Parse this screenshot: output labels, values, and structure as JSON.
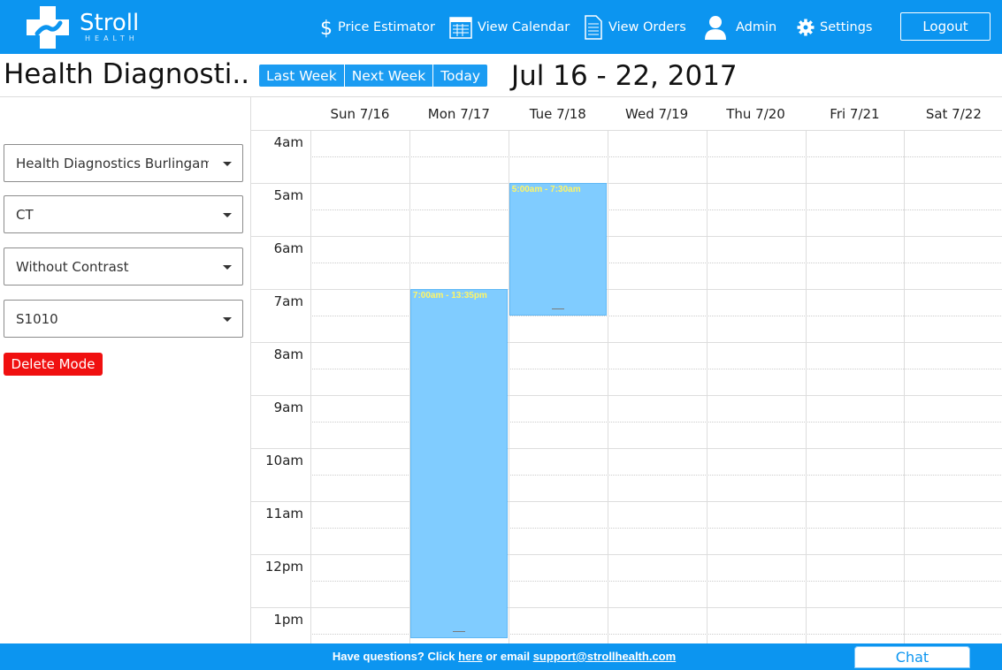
{
  "brand": {
    "name": "Stroll",
    "tagline": "HEALTH",
    "color": "#0c95f0"
  },
  "nav": {
    "items": [
      {
        "label": "Price Estimator",
        "icon": "dollar-icon"
      },
      {
        "label": "View Calendar",
        "icon": "calendar-icon"
      },
      {
        "label": "View Orders",
        "icon": "document-icon"
      },
      {
        "label": "Admin",
        "icon": "user-icon"
      },
      {
        "label": "Settings",
        "icon": "gear-icon"
      }
    ],
    "logout_label": "Logout"
  },
  "header": {
    "title": "Health Diagnosti...",
    "buttons": {
      "last_week": "Last Week",
      "next_week": "Next Week",
      "today": "Today"
    },
    "date_range": "Jul 16 - 22, 2017"
  },
  "sidebar": {
    "location": "Health Diagnostics Burlingame",
    "modality": "CT",
    "contrast": "Without Contrast",
    "code": "S1010",
    "delete_mode_label": "Delete Mode"
  },
  "calendar": {
    "days": [
      "Sun 7/16",
      "Mon 7/17",
      "Tue 7/18",
      "Wed 7/19",
      "Thu 7/20",
      "Fri 7/21",
      "Sat 7/22"
    ],
    "hours": [
      "4am",
      "5am",
      "6am",
      "7am",
      "8am",
      "9am",
      "10am",
      "11am",
      "12pm",
      "1pm"
    ],
    "events": [
      {
        "day_index": 1,
        "label": "7:00am - 13:35pm",
        "start_hour": 7.0,
        "end_hour": 13.583
      },
      {
        "day_index": 2,
        "label": "5:00am - 7:30am",
        "start_hour": 5.0,
        "end_hour": 7.5
      }
    ],
    "event_color": "#80ccff",
    "event_text_color": "#fff566"
  },
  "footer": {
    "prefix": "Have questions? Click ",
    "here_link": "here",
    "middle": " or email ",
    "email": "support@strollhealth.com",
    "chat_label": "Chat"
  }
}
